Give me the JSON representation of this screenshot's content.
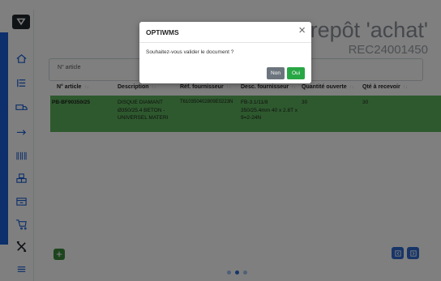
{
  "page": {
    "title": "entrepôt 'achat'",
    "subtitle": "REC24001450"
  },
  "sidebar": {
    "items": [
      {
        "icon": "home-icon"
      },
      {
        "icon": "list-icon"
      },
      {
        "icon": "truck-icon"
      },
      {
        "icon": "arrow-right-icon"
      },
      {
        "icon": "barcode-icon"
      },
      {
        "icon": "boxes-icon"
      },
      {
        "icon": "box-icon"
      },
      {
        "icon": "cart-icon"
      },
      {
        "icon": "tools-icon"
      },
      {
        "icon": "menu-icon"
      }
    ]
  },
  "filter": {
    "label": "N° article"
  },
  "table": {
    "headers": [
      "N° article",
      "Description",
      "Réf. fournisseur",
      "Desc. fournisseur",
      "Quantité ouverte",
      "Qté à recevoir"
    ],
    "rows": [
      {
        "article": "PB-BF90350/25",
        "description": "DISQUE DIAMANT Ø350/25.4 BETON - UNIVERSEL MATERI",
        "ref_fournisseur": "T610350402809E0223N",
        "desc_fournisseur": "FB-3.1/11/8 350/25.4mm 40 x 2.8T x 9=2-24N",
        "quantite_ouverte": "30",
        "qte_a_recevoir": "30"
      }
    ]
  },
  "modal": {
    "title": "OPTIWMS",
    "message": "Souhaitez-vous valider le document ?",
    "cancel_label": "Non",
    "confirm_label": "Oui"
  },
  "colors": {
    "accent": "#1a5fd6",
    "row_highlight": "#5db35d",
    "confirm": "#28a745",
    "cancel": "#6c757d"
  }
}
